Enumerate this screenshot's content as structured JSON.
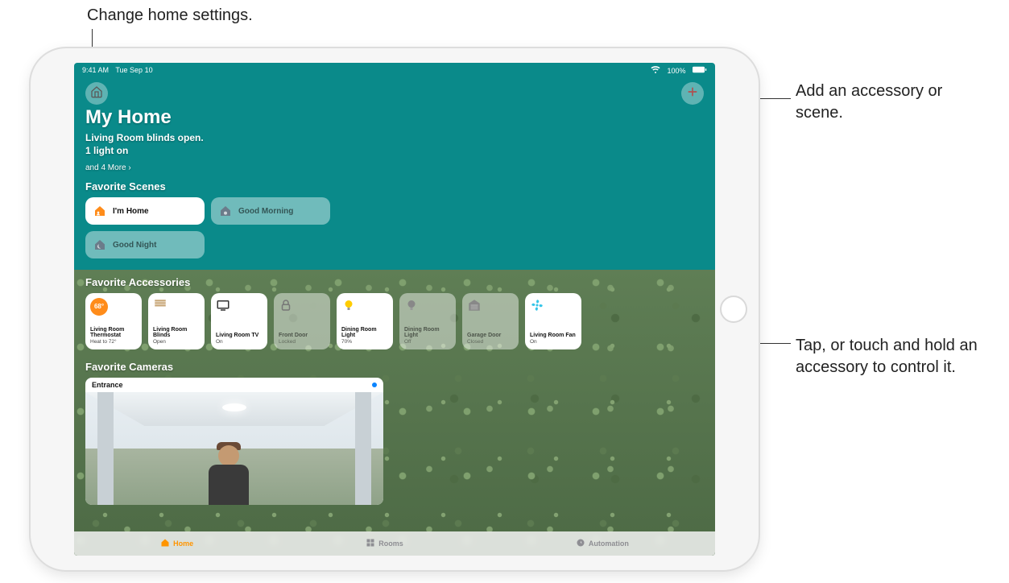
{
  "annotations": {
    "settings": "Change home settings.",
    "add": "Add an accessory or scene.",
    "accessory": "Tap, or touch and hold an accessory to control it."
  },
  "statusbar": {
    "time": "9:41 AM",
    "date": "Tue Sep 10",
    "wifi": "wifi-icon",
    "battery_pct": "100%"
  },
  "header": {
    "home_icon": "home-settings-icon",
    "add_icon": "plus-icon"
  },
  "page": {
    "title": "My Home",
    "status_line1": "Living Room blinds open.",
    "status_line2": "1 light on",
    "more_link": "and 4 More ›"
  },
  "sections": {
    "scenes_title": "Favorite Scenes",
    "accessories_title": "Favorite Accessories",
    "cameras_title": "Favorite Cameras"
  },
  "scenes": [
    {
      "label": "I'm Home",
      "icon": "person-home-icon",
      "active": true,
      "icon_color": "#ff8c1a"
    },
    {
      "label": "Good Morning",
      "icon": "sunrise-home-icon",
      "active": false,
      "icon_color": "#6b7c8a"
    },
    {
      "label": "Good Night",
      "icon": "moon-home-icon",
      "active": false,
      "icon_color": "#6b7c8a"
    }
  ],
  "accessories": [
    {
      "name": "Living Room Thermostat",
      "state": "Heat to 72°",
      "icon": "thermostat-icon",
      "badge": "68°",
      "on": true
    },
    {
      "name": "Living Room Blinds",
      "state": "Open",
      "icon": "blinds-icon",
      "on": true
    },
    {
      "name": "Living Room TV",
      "state": "On",
      "icon": "tv-icon",
      "on": true
    },
    {
      "name": "Front Door",
      "state": "Locked",
      "icon": "lock-icon",
      "on": false
    },
    {
      "name": "Dining Room Light",
      "state": "70%",
      "icon": "bulb-icon",
      "on": true,
      "icon_color": "#ffcc00"
    },
    {
      "name": "Dining Room Light",
      "state": "Off",
      "icon": "bulb-icon",
      "on": false
    },
    {
      "name": "Garage Door",
      "state": "Closed",
      "icon": "garage-icon",
      "on": false
    },
    {
      "name": "Living Room Fan",
      "state": "On",
      "icon": "fan-icon",
      "on": true,
      "icon_color": "#34c5e8"
    }
  ],
  "cameras": [
    {
      "label": "Entrance",
      "live": true
    }
  ],
  "tabs": [
    {
      "label": "Home",
      "icon": "home-tab-icon",
      "active": true
    },
    {
      "label": "Rooms",
      "icon": "rooms-tab-icon",
      "active": false
    },
    {
      "label": "Automation",
      "icon": "automation-tab-icon",
      "active": false
    }
  ]
}
